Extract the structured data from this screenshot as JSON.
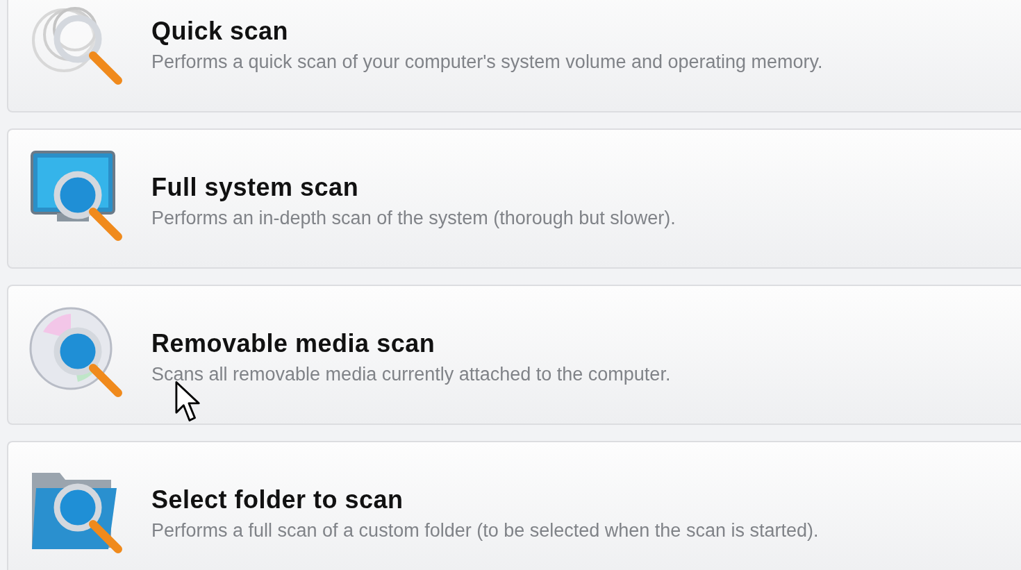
{
  "scans": [
    {
      "kind": "quick",
      "title": "Quick scan",
      "description": "Performs a quick scan of your computer's system volume and operating memory."
    },
    {
      "kind": "full",
      "title": "Full system scan",
      "description": "Performs an in-depth scan of the system (thorough but slower)."
    },
    {
      "kind": "removable",
      "title": "Removable media scan",
      "description": "Scans all removable media currently attached to the computer."
    },
    {
      "kind": "folder",
      "title": "Select folder to scan",
      "description": "Performs a full scan of a custom folder (to be selected when the scan is started)."
    }
  ]
}
